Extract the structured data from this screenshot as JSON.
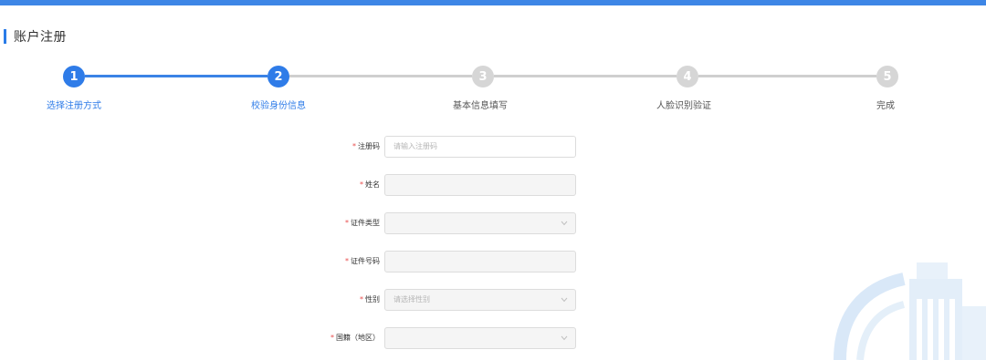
{
  "page": {
    "title": "账户注册"
  },
  "steps": [
    {
      "number": "1",
      "label": "选择注册方式",
      "status": "active"
    },
    {
      "number": "2",
      "label": "校验身份信息",
      "status": "active"
    },
    {
      "number": "3",
      "label": "基本信息填写",
      "status": "inactive"
    },
    {
      "number": "4",
      "label": "人脸识别验证",
      "status": "inactive"
    },
    {
      "number": "5",
      "label": "完成",
      "status": "inactive"
    }
  ],
  "form": {
    "required_mark": "*",
    "fields": {
      "reg_code": {
        "label": "注册码",
        "placeholder": "请输入注册码",
        "value": ""
      },
      "name": {
        "label": "姓名",
        "value": ""
      },
      "id_type": {
        "label": "证件类型",
        "value": ""
      },
      "id_number": {
        "label": "证件号码",
        "value": ""
      },
      "gender": {
        "label": "性别",
        "placeholder": "请选择性别",
        "value": ""
      },
      "nationality": {
        "label": "国籍（地区）",
        "value": ""
      }
    }
  },
  "colors": {
    "accent": "#2f7ce8",
    "top_bar": "#3d86e6",
    "step_inactive": "#d6d6d6",
    "required": "#e84d4d",
    "input_disabled_bg": "#f5f5f5"
  },
  "icons": {
    "select_arrow": "chevron-down-icon",
    "watermark": "building-logo-icon"
  }
}
